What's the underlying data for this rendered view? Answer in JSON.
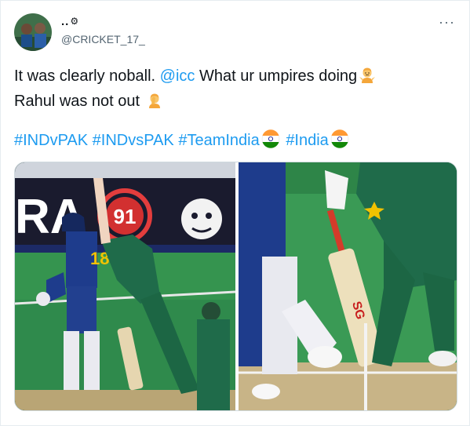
{
  "author": {
    "display_name": "..",
    "badge_icon": "gear-icon",
    "handle": "@CRICKET_17_"
  },
  "tweet": {
    "line1_text": "It was clearly noball.",
    "mention": "@icc",
    "line1_rest": "What ur umpires doing",
    "line2_text": "Rahul was not out",
    "hashtags": [
      "#INDvPAK",
      "#INDvsPAK",
      "#TeamIndia",
      "#India"
    ]
  },
  "media": {
    "left_image": {
      "jersey_number": "18",
      "board_number": "91",
      "board_text": "RA"
    },
    "right_image": {
      "bat_brand": "SG"
    }
  },
  "colors": {
    "link": "#1d9bf0",
    "text": "#0f1419",
    "secondary": "#536471",
    "india_jersey": "#1e3c8c",
    "pakistan_jersey": "#1f6b4a"
  }
}
